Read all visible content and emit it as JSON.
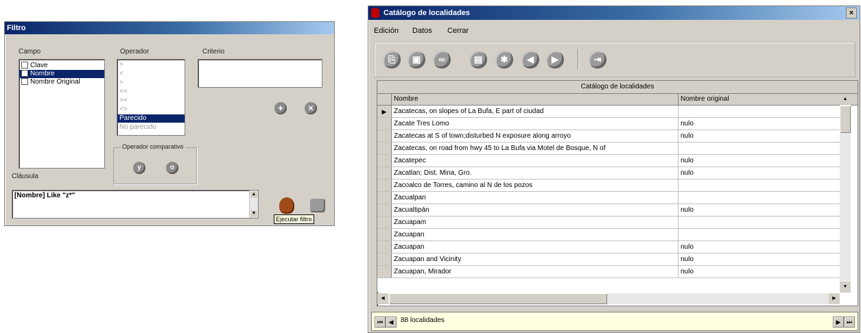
{
  "filter_dialog": {
    "title": "Filtro",
    "campo_label": "Campo",
    "operador_label": "Operador",
    "criterio_label": "Criterio",
    "campo_items": [
      {
        "label": "Clave",
        "checked": false,
        "selected": false
      },
      {
        "label": "Nombre",
        "checked": true,
        "selected": true
      },
      {
        "label": "Nombre Original",
        "checked": false,
        "selected": false
      }
    ],
    "operador_items": [
      "=",
      "<",
      ">",
      "<=",
      ">=",
      "<>",
      "Parecido",
      "No parecido"
    ],
    "operador_selected": "Parecido",
    "criterio_value": "",
    "operador_comparativo_label": "Operador comparativo",
    "clausula_label": "Cláusula",
    "clausula_value": "[Nombre] Like \"z*\"",
    "tooltip": "Ejecutar filtro",
    "icons": {
      "add": "plus-icon",
      "remove": "remove-icon",
      "and": "and-icon",
      "or": "or-icon",
      "execute": "run-filter-icon",
      "exit": "exit-icon"
    }
  },
  "catalog_window": {
    "title": "Catálogo de localidades",
    "close": "×",
    "menu": [
      "Edición",
      "Datos",
      "Cerrar"
    ],
    "toolbar_icons": [
      "copy-icon",
      "save-icon",
      "link-icon",
      "book-icon",
      "filter-icon",
      "back-icon",
      "forward-icon",
      "exit-icon"
    ],
    "grid_caption": "Catálogo de localidades",
    "columns": [
      "Nombre",
      "Nombre original"
    ],
    "rows": [
      {
        "nombre": "Zacatecas, on slopes of La Bufa, E part of ciudad",
        "original": "",
        "current": true
      },
      {
        "nombre": "Zacate Tres Lomo",
        "original": "nulo"
      },
      {
        "nombre": "Zacatecas at S of town;disturbed N exposure along arroyo",
        "original": "nulo"
      },
      {
        "nombre": "Zacatecas, on road from hwy 45 to La Bufa via Motel de Bosque, N of",
        "original": ""
      },
      {
        "nombre": "Zacatepec",
        "original": "nulo"
      },
      {
        "nombre": "Zacatlan; Dist. Mina, Gro.",
        "original": "nulo"
      },
      {
        "nombre": "Zacoalco de Torres, camino al N de los pozos",
        "original": ""
      },
      {
        "nombre": "Zacualpan",
        "original": ""
      },
      {
        "nombre": "Zacualtipán",
        "original": "nulo"
      },
      {
        "nombre": "Zacuapam",
        "original": ""
      },
      {
        "nombre": "Zacuapan",
        "original": ""
      },
      {
        "nombre": "Zacuapan",
        "original": "nulo"
      },
      {
        "nombre": "Zacuapan and Vicinity",
        "original": "nulo"
      },
      {
        "nombre": "Zacuapan, Mirador",
        "original": "nulo"
      }
    ],
    "status_text": "88 localidades",
    "nav": {
      "first": "⏮",
      "prev": "◀",
      "next": "▶",
      "last": "⏭"
    }
  }
}
